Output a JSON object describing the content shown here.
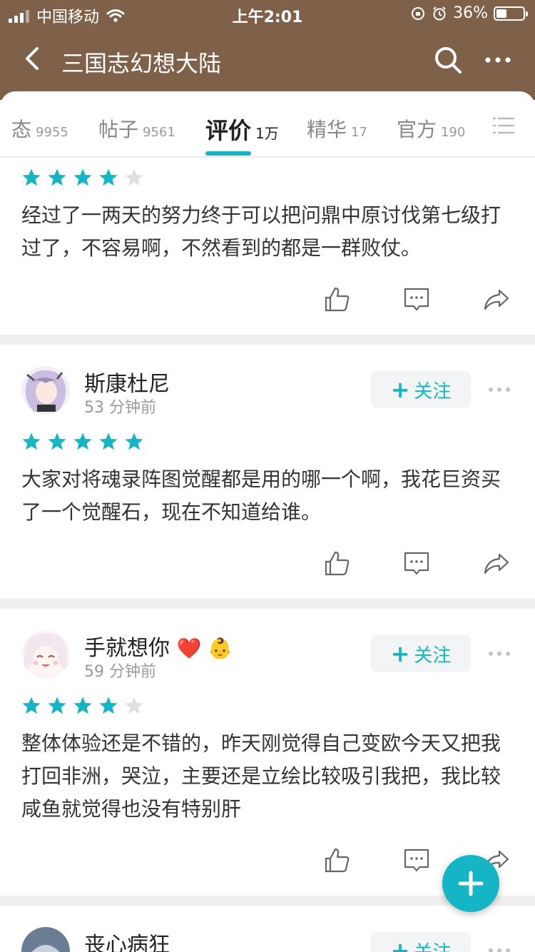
{
  "status_bar": {
    "carrier": "中国移动",
    "time": "上午2:01",
    "battery": "36%",
    "battery_level": 0.36
  },
  "nav": {
    "title": "三国志幻想大陆"
  },
  "tabs": [
    {
      "label": "态",
      "count": "9955"
    },
    {
      "label": "帖子",
      "count": "9561"
    },
    {
      "label": "评价",
      "count": "1万",
      "active": true
    },
    {
      "label": "精华",
      "count": "17"
    },
    {
      "label": "官方",
      "count": "190"
    }
  ],
  "reviews": [
    {
      "stars": 4,
      "content": "经过了一两天的努力终于可以把问鼎中原讨伐第七级打过了，不容易啊，不然看到的都是一群败仗。"
    },
    {
      "username": "斯康杜尼",
      "time": "53 分钟前",
      "follow_label": "关注",
      "stars": 5,
      "content": "大家对将魂录阵图觉醒都是用的哪一个啊，我花巨资买了一个觉醒石，现在不知道给谁。"
    },
    {
      "username": "手就想你",
      "emoji": "❤️ 👶",
      "time": "59 分钟前",
      "follow_label": "关注",
      "stars": 4,
      "content": "整体体验还是不错的，昨天刚觉得自己变欧今天又把我打回非洲，哭泣，主要还是立绘比较吸引我把，我比较咸鱼就觉得也没有特别肝"
    },
    {
      "username": "丧心病狂",
      "follow_label": "关注"
    }
  ],
  "colors": {
    "header_bg": "#7f6149",
    "accent": "#15b5c6",
    "star_empty": "#e0e0e0"
  }
}
